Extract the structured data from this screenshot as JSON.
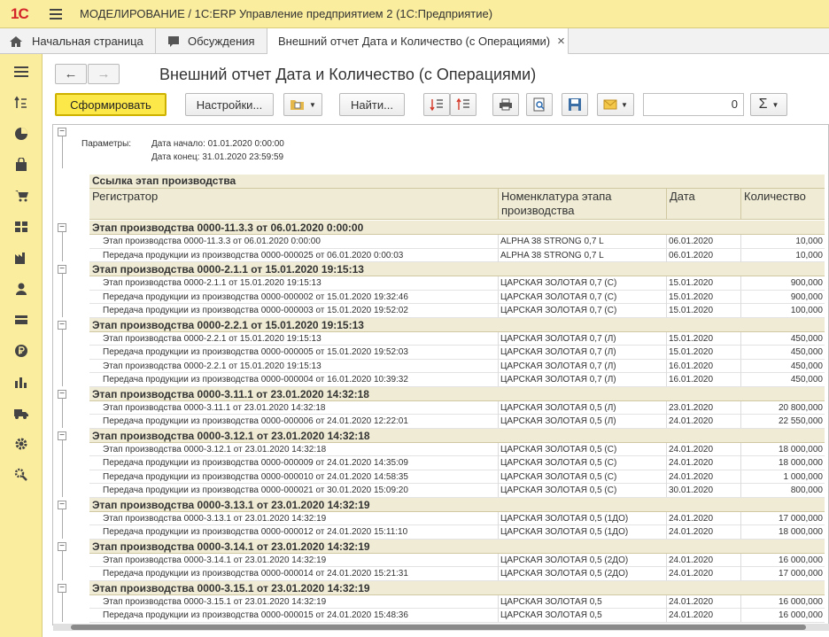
{
  "titlebar": {
    "logo": "1С",
    "title": "МОДЕЛИРОВАНИЕ / 1С:ERP Управление предприятием 2  (1С:Предприятие)"
  },
  "tabs": [
    {
      "label": "Начальная страница",
      "icon": "home-icon"
    },
    {
      "label": "Обсуждения",
      "icon": "chat-icon"
    },
    {
      "label": "Внешний отчет Дата и Количество (с Операциями)",
      "close": "×"
    }
  ],
  "sidebar": [
    "menu-icon",
    "tasks-icon",
    "chart-icon",
    "bag-icon",
    "cart-icon",
    "grid-icon",
    "factory-icon",
    "person-icon",
    "card-icon",
    "money-icon",
    "bars-icon",
    "truck-icon",
    "gear-icon",
    "tools-icon"
  ],
  "nav": {
    "back": "←",
    "forward": "→"
  },
  "report_title": "Внешний отчет Дата и Количество (с Операциями)",
  "toolbar": {
    "generate": "Сформировать",
    "settings": "Настройки...",
    "find": "Найти...",
    "num_value": "0",
    "sum": "Σ"
  },
  "params": {
    "label": "Параметры:",
    "start": "Дата начало: 01.01.2020 0:00:00",
    "end": "Дата конец: 31.01.2020 23:59:59"
  },
  "header": {
    "link": "Ссылка этап производства",
    "col1": "Регистратор",
    "col2": "Номенклатура этапа производства",
    "col3": "Дата",
    "col4": "Количество"
  },
  "groups": [
    {
      "title": "Этап производства 0000-11.3.3 от 06.01.2020 0:00:00",
      "rows": [
        [
          "Этап производства 0000-11.3.3 от 06.01.2020 0:00:00",
          "ALPHA 38 STRONG 0,7 L",
          "06.01.2020",
          "10,000"
        ],
        [
          "Передача продукции из производства 0000-000025 от 06.01.2020 0:00:03",
          "ALPHA 38 STRONG 0,7 L",
          "06.01.2020",
          "10,000"
        ]
      ]
    },
    {
      "title": "Этап производства 0000-2.1.1 от 15.01.2020 19:15:13",
      "rows": [
        [
          "Этап производства 0000-2.1.1 от 15.01.2020 19:15:13",
          "ЦАРСКАЯ ЗОЛОТАЯ 0,7 (С)",
          "15.01.2020",
          "900,000"
        ],
        [
          "Передача продукции из производства 0000-000002 от 15.01.2020 19:32:46",
          "ЦАРСКАЯ ЗОЛОТАЯ 0,7 (С)",
          "15.01.2020",
          "900,000"
        ],
        [
          "Передача продукции из производства 0000-000003 от 15.01.2020 19:52:02",
          "ЦАРСКАЯ ЗОЛОТАЯ 0,7 (С)",
          "15.01.2020",
          "100,000"
        ]
      ]
    },
    {
      "title": "Этап производства 0000-2.2.1 от 15.01.2020 19:15:13",
      "rows": [
        [
          "Этап производства 0000-2.2.1 от 15.01.2020 19:15:13",
          "ЦАРСКАЯ ЗОЛОТАЯ 0,7 (Л)",
          "15.01.2020",
          "450,000"
        ],
        [
          "Передача продукции из производства 0000-000005 от 15.01.2020 19:52:03",
          "ЦАРСКАЯ ЗОЛОТАЯ 0,7 (Л)",
          "15.01.2020",
          "450,000"
        ],
        [
          "Этап производства 0000-2.2.1 от 15.01.2020 19:15:13",
          "ЦАРСКАЯ ЗОЛОТАЯ 0,7 (Л)",
          "16.01.2020",
          "450,000"
        ],
        [
          "Передача продукции из производства 0000-000004 от 16.01.2020 10:39:32",
          "ЦАРСКАЯ ЗОЛОТАЯ 0,7 (Л)",
          "16.01.2020",
          "450,000"
        ]
      ]
    },
    {
      "title": "Этап производства 0000-3.11.1 от 23.01.2020 14:32:18",
      "rows": [
        [
          "Этап производства 0000-3.11.1 от 23.01.2020 14:32:18",
          "ЦАРСКАЯ ЗОЛОТАЯ 0,5 (Л)",
          "23.01.2020",
          "20 800,000"
        ],
        [
          "Передача продукции из производства 0000-000006 от 24.01.2020 12:22:01",
          "ЦАРСКАЯ ЗОЛОТАЯ 0,5 (Л)",
          "24.01.2020",
          "22 550,000"
        ]
      ]
    },
    {
      "title": "Этап производства 0000-3.12.1 от 23.01.2020 14:32:18",
      "rows": [
        [
          "Этап производства 0000-3.12.1 от 23.01.2020 14:32:18",
          "ЦАРСКАЯ ЗОЛОТАЯ 0,5 (С)",
          "24.01.2020",
          "18 000,000"
        ],
        [
          "Передача продукции из производства 0000-000009 от 24.01.2020 14:35:09",
          "ЦАРСКАЯ ЗОЛОТАЯ 0,5 (С)",
          "24.01.2020",
          "18 000,000"
        ],
        [
          "Передача продукции из производства 0000-000010 от 24.01.2020 14:58:35",
          "ЦАРСКАЯ ЗОЛОТАЯ 0,5 (С)",
          "24.01.2020",
          "1 000,000"
        ],
        [
          "Передача продукции из производства 0000-000021 от 30.01.2020 15:09:20",
          "ЦАРСКАЯ ЗОЛОТАЯ 0,5 (С)",
          "30.01.2020",
          "800,000"
        ]
      ]
    },
    {
      "title": "Этап производства 0000-3.13.1 от 23.01.2020 14:32:19",
      "rows": [
        [
          "Этап производства 0000-3.13.1 от 23.01.2020 14:32:19",
          "ЦАРСКАЯ ЗОЛОТАЯ 0,5 (1ДО)",
          "24.01.2020",
          "17 000,000"
        ],
        [
          "Передача продукции из производства 0000-000012 от 24.01.2020 15:11:10",
          "ЦАРСКАЯ ЗОЛОТАЯ 0,5 (1ДО)",
          "24.01.2020",
          "18 000,000"
        ]
      ]
    },
    {
      "title": "Этап производства 0000-3.14.1 от 23.01.2020 14:32:19",
      "rows": [
        [
          "Этап производства 0000-3.14.1 от 23.01.2020 14:32:19",
          "ЦАРСКАЯ ЗОЛОТАЯ 0,5 (2ДО)",
          "24.01.2020",
          "16 000,000"
        ],
        [
          "Передача продукции из производства 0000-000014 от 24.01.2020 15:21:31",
          "ЦАРСКАЯ ЗОЛОТАЯ 0,5 (2ДО)",
          "24.01.2020",
          "17 000,000"
        ]
      ]
    },
    {
      "title": "Этап производства 0000-3.15.1 от 23.01.2020 14:32:19",
      "rows": [
        [
          "Этап производства 0000-3.15.1 от 23.01.2020 14:32:19",
          "ЦАРСКАЯ ЗОЛОТАЯ 0,5",
          "24.01.2020",
          "16 000,000"
        ],
        [
          "Передача продукции из производства 0000-000015 от 24.01.2020 15:48:36",
          "ЦАРСКАЯ ЗОЛОТАЯ 0,5",
          "24.01.2020",
          "16 000,000"
        ]
      ]
    }
  ]
}
